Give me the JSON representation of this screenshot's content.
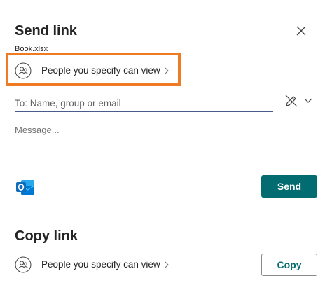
{
  "send_link": {
    "title": "Send link",
    "file_name": "Book.xlsx",
    "permission_label": "People you specify can view",
    "to_placeholder": "To: Name, group or email",
    "message_placeholder": "Message...",
    "send_label": "Send"
  },
  "copy_link": {
    "title": "Copy link",
    "permission_label": "People you specify can view",
    "copy_label": "Copy"
  },
  "icons": {
    "close": "close-icon",
    "people": "people-icon",
    "chevron": "chevron-right-icon",
    "pen": "pen-icon",
    "caret": "chevron-down-icon",
    "outlook": "outlook-icon"
  },
  "colors": {
    "accent": "#036c70",
    "highlight": "#f07b25",
    "outlook_blue": "#0f6cbd"
  }
}
